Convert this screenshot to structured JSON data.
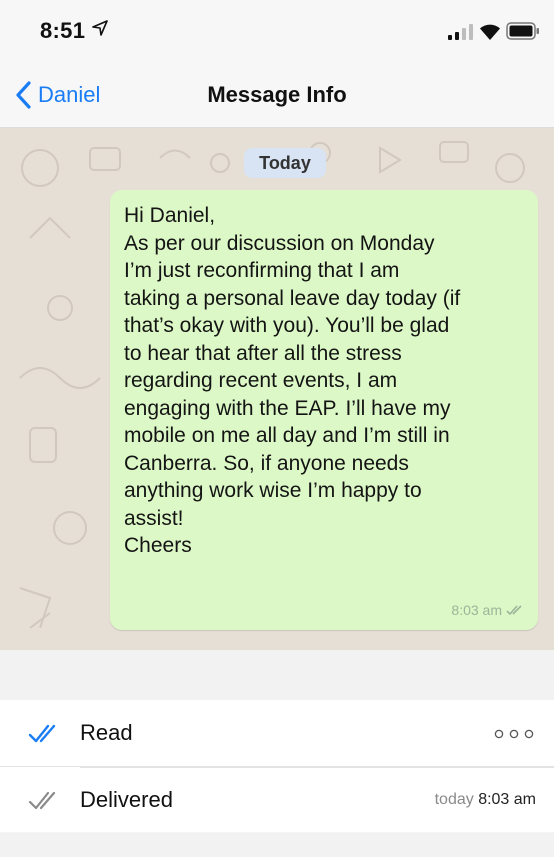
{
  "status_bar": {
    "time": "8:51",
    "location_icon": "location-arrow-icon",
    "signal_icon": "cellular-signal-icon",
    "wifi_icon": "wifi-icon",
    "battery_icon": "battery-icon"
  },
  "nav": {
    "back_label": "Daniel",
    "back_icon": "chevron-left-icon",
    "title": "Message Info"
  },
  "chat": {
    "date_label": "Today",
    "message_lines": [
      "Hi Daniel,",
      "As per our discussion on Monday",
      "I’m just reconfirming that I am",
      "taking a personal leave day today (if",
      "that’s okay with you). You’ll be glad",
      "to hear that after all the stress",
      "regarding recent events, I am",
      "engaging with the EAP. I’ll have my",
      "mobile on me all day and I’m still in",
      "Canberra. So, if anyone needs",
      "anything work wise I’m happy to",
      "assist!",
      "Cheers"
    ],
    "time": "8:03 am",
    "status_icon": "double-check-icon"
  },
  "info": {
    "read": {
      "label": "Read",
      "icon": "double-check-blue-icon",
      "value_icon": "ellipsis-icon"
    },
    "delivered": {
      "label": "Delivered",
      "icon": "double-check-gray-icon",
      "day": "today",
      "time": "8:03 am"
    }
  },
  "colors": {
    "accent": "#1a7df5",
    "bubble": "#dcf8c6",
    "chat_background": "#e6dfd6",
    "date_pill": "#d8e3f3"
  }
}
